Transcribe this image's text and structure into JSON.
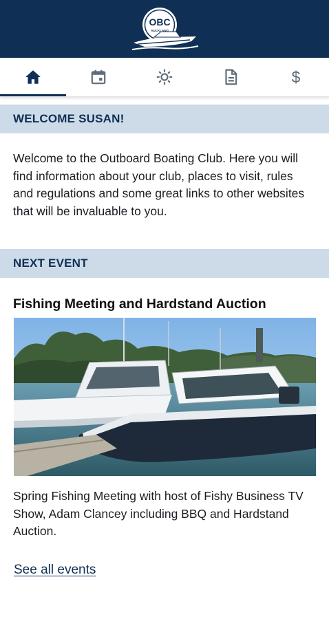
{
  "header": {
    "logo_text": "OBC",
    "logo_subtext": "AUCKLAND",
    "background_color": "#0f2f55"
  },
  "tabs": [
    {
      "name": "home",
      "icon": "home-icon",
      "active": true
    },
    {
      "name": "events",
      "icon": "calendar-icon",
      "active": false
    },
    {
      "name": "weather",
      "icon": "sun-icon",
      "active": false
    },
    {
      "name": "documents",
      "icon": "document-icon",
      "active": false
    },
    {
      "name": "payments",
      "icon": "dollar-icon",
      "active": false
    }
  ],
  "welcome": {
    "heading": "WELCOME SUSAN!",
    "body": "Welcome to the Outboard Boating Club. Here you will find information about your club, places to visit, rules and regulations and some great links to other websites that will be invaluable to you."
  },
  "next_event": {
    "heading": "NEXT EVENT",
    "title": "Fishing Meeting and Hardstand Auction",
    "description": "Spring Fishing Meeting with host of Fishy Business TV Show, Adam Clancey including BBQ and Hardstand Auction.",
    "see_all_label": "See all events"
  },
  "colors": {
    "primary": "#0f2f55",
    "section_bar": "#cddbe8",
    "text": "#1b1f24"
  }
}
